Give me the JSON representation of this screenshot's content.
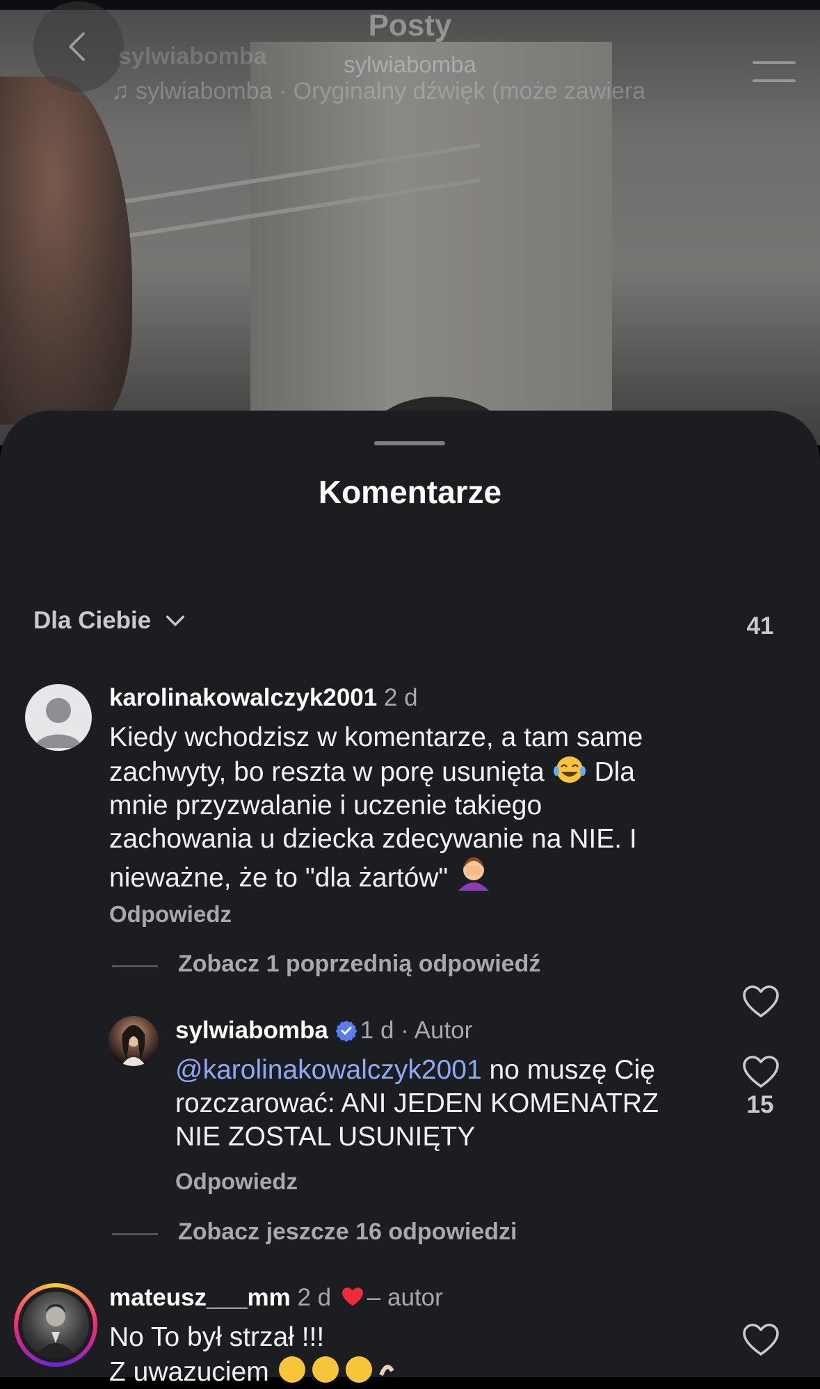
{
  "post": {
    "header_title": "Posty",
    "header_username": "sylwiabomba",
    "ghost_username": "sylwiabomba",
    "audio_line": "♫  sylwiabomba · Oryginalny dźwięk  (może zawiera"
  },
  "sheet": {
    "title": "Komentarze",
    "sort_label": "Dla Ciebie"
  },
  "comments": [
    {
      "username": "karolinakowalczyk2001",
      "time": "2 d",
      "text_lines": [
        "Kiedy wchodzisz w komentarze, a tam same",
        "zachwyty, bo reszta w porę usunięta",
        "Dla",
        "mnie przyzwalanie i uczenie takiego",
        "zachowania u dziecka zdecywanie na NIE. I",
        "nieważne, że to \"dla żartów\""
      ],
      "likes": "41",
      "reply_label": "Odpowiedz",
      "thread_label": "Zobacz 1 poprzednią odpowiedź"
    },
    {
      "username": "sylwiabomba",
      "time": "1 d",
      "author_tag": "· Autor",
      "mention": "@karolinakowalczyk2001",
      "text_lines": [
        "no muszę Cię",
        "rozczarować: ANI JEDEN KOMENATRZ",
        "NIE ZOSTAL USUNIĘTY"
      ],
      "likes": "15",
      "reply_label": "Odpowiedz",
      "thread_label": "Zobacz jeszcze 16 odpowiedzi"
    },
    {
      "username": "mateusz___mm",
      "time": "2 d",
      "author_liked": "– autor",
      "text_lines": [
        "No To był strzał !!!",
        "Z uwazuciem"
      ]
    }
  ],
  "colors": {
    "sheet_bg": "#1c1d21",
    "mention": "#8fa9f5",
    "verified": "#5b7cf0",
    "heart_red": "#ee2a3c"
  },
  "icons": [
    "back-arrow-icon",
    "menu-icon",
    "chevron-down-icon",
    "heart-icon",
    "verified-badge-icon",
    "red-heart-icon"
  ]
}
